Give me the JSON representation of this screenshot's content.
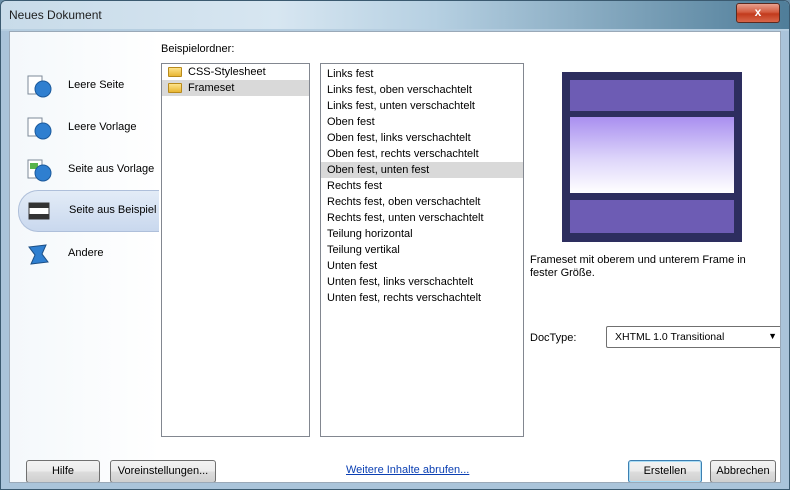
{
  "window": {
    "title": "Neues Dokument",
    "close_glyph": "x"
  },
  "nav": {
    "items": [
      {
        "label": "Leere Seite",
        "icon": "blank-page-icon",
        "selected": false
      },
      {
        "label": "Leere Vorlage",
        "icon": "blank-template-icon",
        "selected": false
      },
      {
        "label": "Seite aus Vorlage",
        "icon": "page-from-template-icon",
        "selected": false
      },
      {
        "label": "Seite aus Beispiel",
        "icon": "page-from-sample-icon",
        "selected": true
      },
      {
        "label": "Andere",
        "icon": "other-icon",
        "selected": false
      }
    ]
  },
  "folders": {
    "label": "Beispielordner:",
    "items": [
      {
        "label": "CSS-Stylesheet",
        "selected": false
      },
      {
        "label": "Frameset",
        "selected": true
      }
    ]
  },
  "pages": {
    "items": [
      "Links fest",
      "Links fest, oben verschachtelt",
      "Links fest, unten verschachtelt",
      "Oben fest",
      "Oben fest, links verschachtelt",
      "Oben fest, rechts verschachtelt",
      "Oben fest, unten fest",
      "Rechts fest",
      "Rechts fest, oben verschachtelt",
      "Rechts fest, unten verschachtelt",
      "Teilung horizontal",
      "Teilung vertikal",
      "Unten fest",
      "Unten fest, links verschachtelt",
      "Unten fest, rechts verschachtelt"
    ],
    "selected_index": 6
  },
  "preview": {
    "description": "Frameset mit oberem und unterem Frame in fester Größe.",
    "colors": {
      "border": "#2d2e5f",
      "frame": "#6d5cb4"
    }
  },
  "doctype": {
    "label": "DocType:",
    "value": "XHTML 1.0 Transitional"
  },
  "footer": {
    "help": "Hilfe",
    "preferences": "Voreinstellungen...",
    "more_link": "Weitere Inhalte abrufen...",
    "create": "Erstellen",
    "cancel": "Abbrechen"
  }
}
